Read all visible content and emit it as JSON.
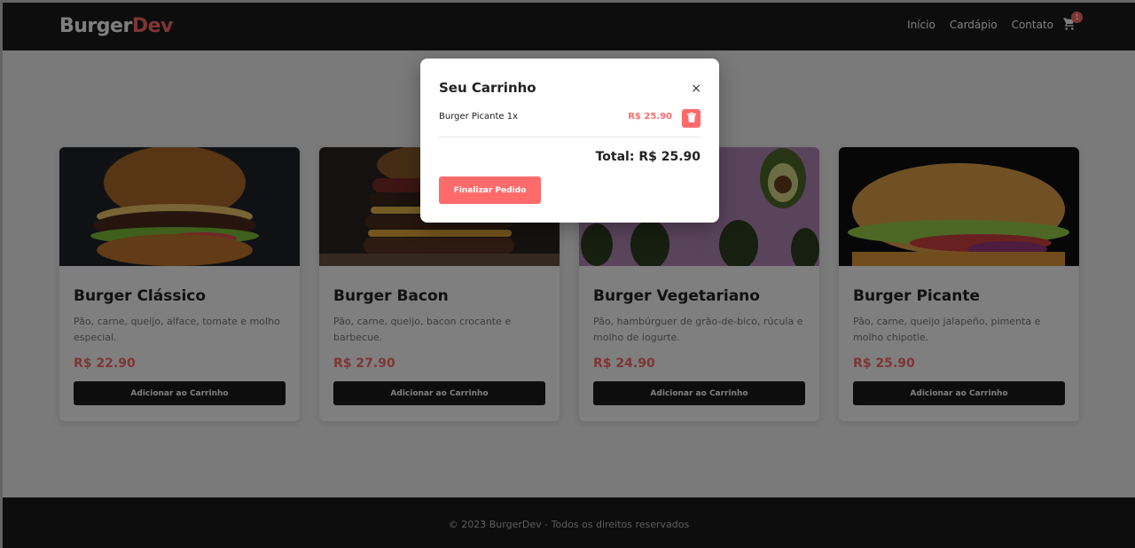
{
  "brand": {
    "part1": "Burger",
    "part2": "Dev",
    "accent_color": "#ff6b6b"
  },
  "nav": {
    "items": [
      "Início",
      "Cardápio",
      "Contato"
    ],
    "cart_count": "1",
    "cart_icon": "cart-icon"
  },
  "products": [
    {
      "name": "Burger Clássico",
      "description": "Pão, carne, queijo, alface, tomate e molho especial.",
      "price": "R$ 22.90",
      "button": "Adicionar ao Carrinho"
    },
    {
      "name": "Burger Bacon",
      "description": "Pão, carne, queijo, bacon crocante e barbecue.",
      "price": "R$ 27.90",
      "button": "Adicionar ao Carrinho"
    },
    {
      "name": "Burger Vegetariano",
      "description": "Pão, hambúrguer de grão-de-bico, rúcula e molho de iogurte.",
      "price": "R$ 24.90",
      "button": "Adicionar ao Carrinho"
    },
    {
      "name": "Burger Picante",
      "description": "Pão, carne, queijo jalapeño, pimenta e molho chipotle.",
      "price": "R$ 25.90",
      "button": "Adicionar ao Carrinho"
    }
  ],
  "footer": {
    "text": "© 2023 BurgerDev - Todos os direitos reservados"
  },
  "cart_modal": {
    "title": "Seu Carrinho",
    "close": "×",
    "items": [
      {
        "name": "Burger Picante 1x",
        "price": "R$ 25.90"
      }
    ],
    "total": "Total: R$ 25.90",
    "checkout": "Finalizar Pedido"
  }
}
